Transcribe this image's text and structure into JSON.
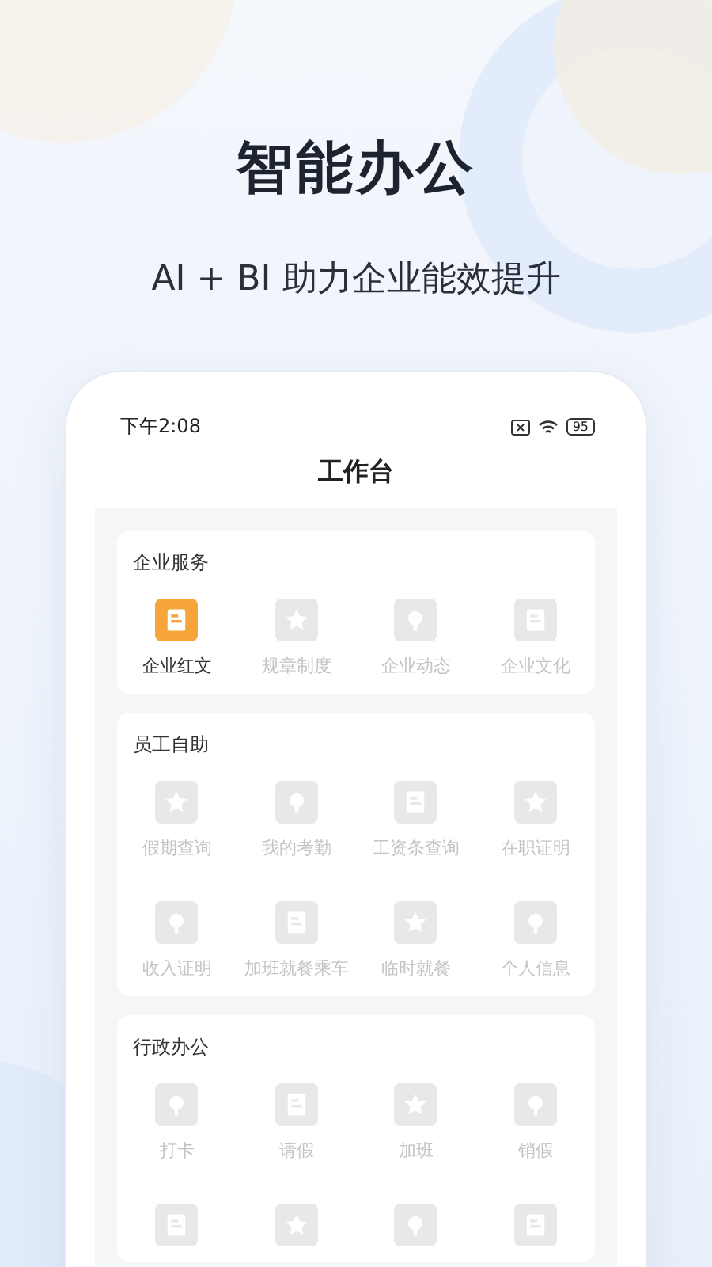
{
  "headline": "智能办公",
  "subtitle": "AI + BI 助力企业能效提升",
  "phone": {
    "status_bar": {
      "time": "下午2:08",
      "battery": "95"
    },
    "title": "工作台",
    "sections": [
      {
        "title": "企业服务",
        "items": [
          {
            "label": "企业红文",
            "disabled": false
          },
          {
            "label": "规章制度",
            "disabled": true
          },
          {
            "label": "企业动态",
            "disabled": true
          },
          {
            "label": "企业文化",
            "disabled": true
          }
        ]
      },
      {
        "title": "员工自助",
        "items": [
          {
            "label": "假期查询",
            "disabled": true
          },
          {
            "label": "我的考勤",
            "disabled": true
          },
          {
            "label": "工资条查询",
            "disabled": true
          },
          {
            "label": "在职证明",
            "disabled": true
          },
          {
            "label": "收入证明",
            "disabled": true
          },
          {
            "label": "加班就餐乘车",
            "disabled": true
          },
          {
            "label": "临时就餐",
            "disabled": true
          },
          {
            "label": "个人信息",
            "disabled": true
          }
        ]
      },
      {
        "title": "行政办公",
        "items": [
          {
            "label": "打卡",
            "disabled": true
          },
          {
            "label": "请假",
            "disabled": true
          },
          {
            "label": "加班",
            "disabled": true
          },
          {
            "label": "销假",
            "disabled": true
          },
          {
            "disabled": true
          },
          {
            "disabled": true
          },
          {
            "disabled": true
          },
          {
            "disabled": true
          }
        ]
      }
    ]
  }
}
